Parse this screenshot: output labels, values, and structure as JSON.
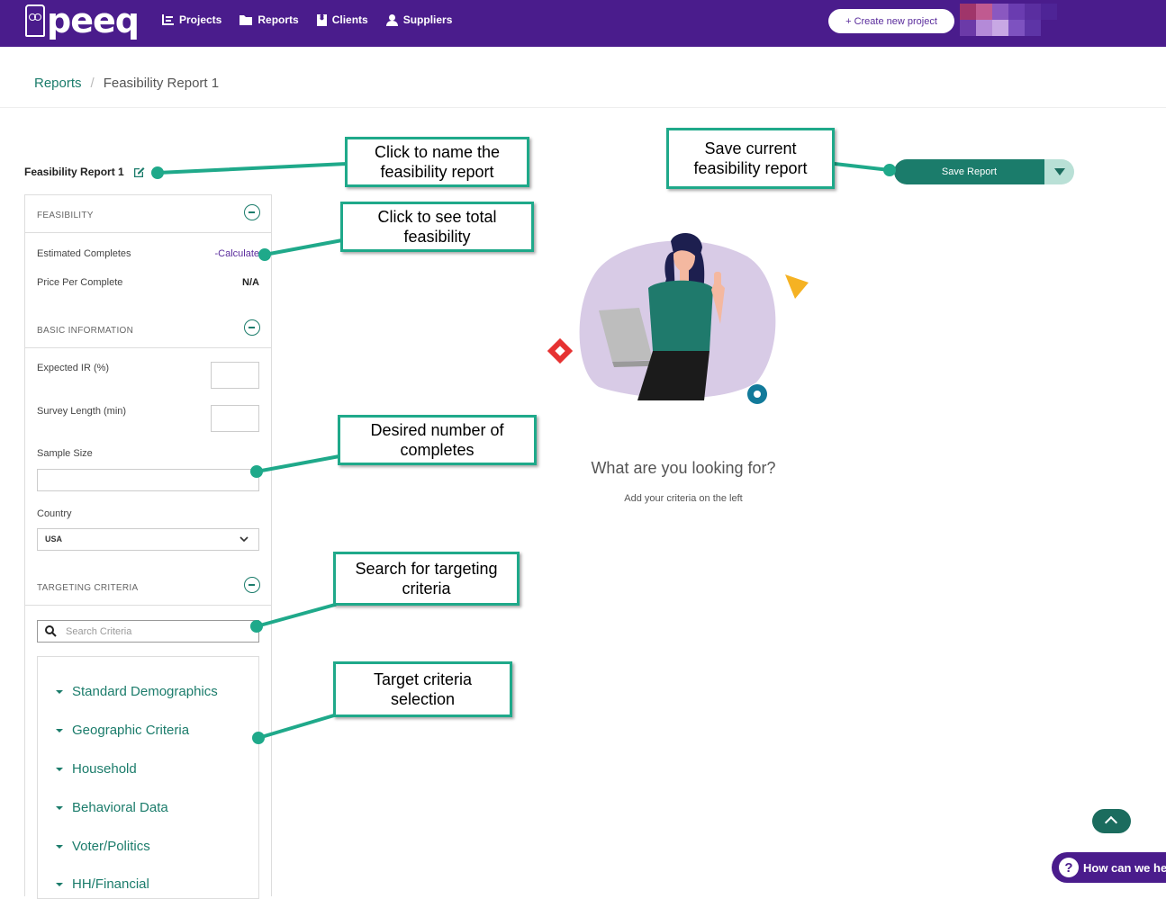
{
  "brand": {
    "name": "peeq"
  },
  "nav": {
    "items": [
      {
        "label": "Projects",
        "icon": "chart-icon"
      },
      {
        "label": "Reports",
        "icon": "folder-icon"
      },
      {
        "label": "Clients",
        "icon": "contact-book-icon"
      },
      {
        "label": "Suppliers",
        "icon": "user-icon"
      }
    ]
  },
  "header": {
    "create_label": "+ Create new project"
  },
  "breadcrumb": {
    "parent": "Reports",
    "separator": "/",
    "current": "Feasibility Report 1"
  },
  "report": {
    "title": "Feasibility Report 1"
  },
  "feasibility": {
    "section_label": "FEASIBILITY",
    "estimated_completes_label": "Estimated Completes",
    "calculate_label": "-Calculate",
    "price_label": "Price Per Complete",
    "price_value": "N/A"
  },
  "basic": {
    "section_label": "BASIC INFORMATION",
    "ir_label": "Expected IR (%)",
    "length_label": "Survey Length (min)",
    "sample_label": "Sample Size",
    "country_label": "Country",
    "country_value": "USA"
  },
  "targeting": {
    "section_label": "TARGETING CRITERIA",
    "search_placeholder": "Search Criteria",
    "criteria": [
      "Standard Demographics",
      "Geographic Criteria",
      "Household",
      "Behavioral Data",
      "Voter/Politics",
      "HH/Financial"
    ]
  },
  "actions": {
    "save_label": "Save Report"
  },
  "empty_state": {
    "title": "What are you looking for?",
    "subtitle": "Add your criteria on the left"
  },
  "callouts": {
    "name": "Click to name the feasibility report",
    "save": "Save current feasibility report",
    "total": "Click to see total feasibility",
    "completes": "Desired number of completes",
    "search": "Search for targeting criteria",
    "target": "Target criteria selection"
  },
  "help": {
    "label": "How can we help?"
  },
  "colors": {
    "brand_purple": "#4a1c8c",
    "accent_teal": "#1b7c6b",
    "callout_border": "#1fa98a"
  }
}
